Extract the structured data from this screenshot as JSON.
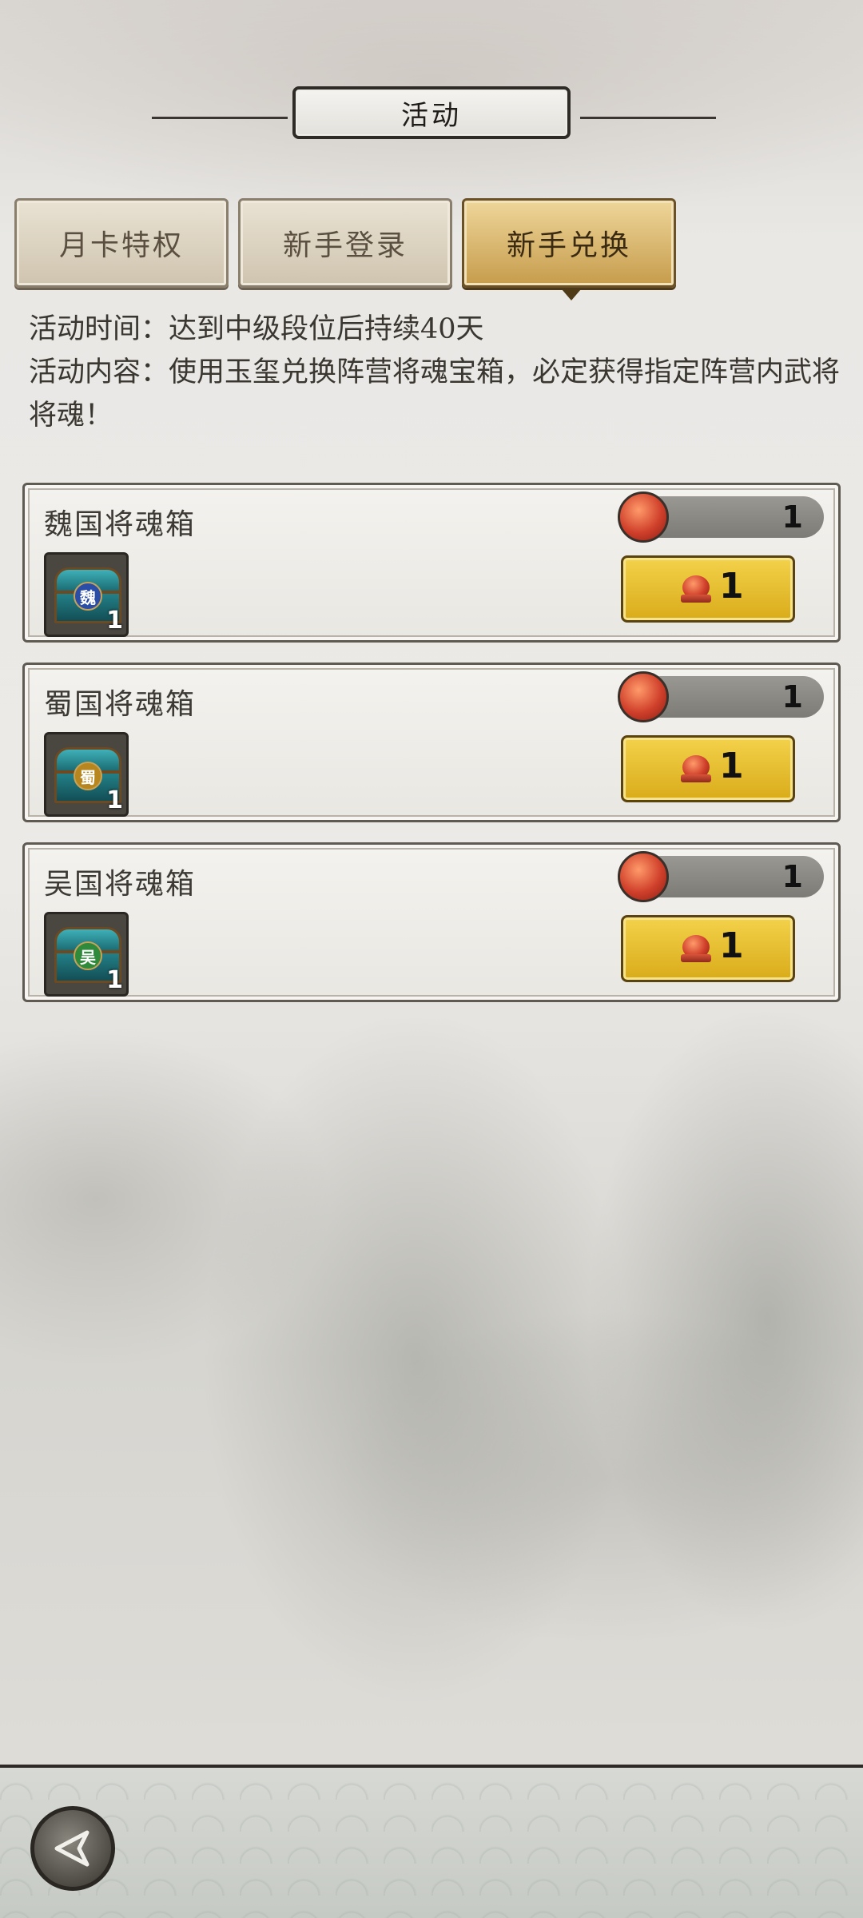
{
  "header": {
    "title": "活动"
  },
  "tabs": [
    {
      "label": "月卡特权",
      "active": false
    },
    {
      "label": "新手登录",
      "active": false
    },
    {
      "label": "新手兑换",
      "active": true
    }
  ],
  "description": {
    "time": "活动时间：达到中级段位后持续40天",
    "content": "活动内容：使用玉玺兑换阵营将魂宝箱，必定获得指定阵营内武将将魂！"
  },
  "cards": [
    {
      "title": "魏国将魂箱",
      "emblem": "魏",
      "emblem_color": "#2a4ea8",
      "item_count": "1",
      "owned": "1",
      "cost": "1"
    },
    {
      "title": "蜀国将魂箱",
      "emblem": "蜀",
      "emblem_color": "#b8861e",
      "item_count": "1",
      "owned": "1",
      "cost": "1"
    },
    {
      "title": "吴国将魂箱",
      "emblem": "吴",
      "emblem_color": "#2f8a3c",
      "item_count": "1",
      "owned": "1",
      "cost": "1"
    }
  ],
  "icons": {
    "back": "back-arrow-icon",
    "seal": "jade-seal-icon",
    "chest": "treasure-chest-icon"
  }
}
